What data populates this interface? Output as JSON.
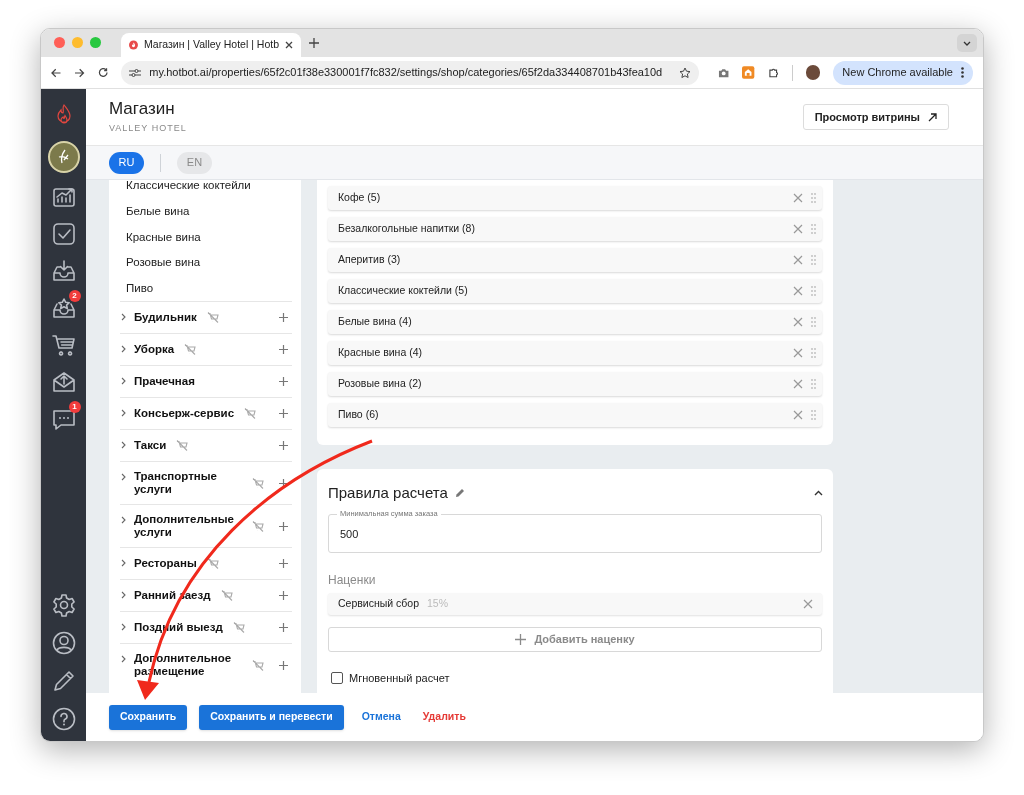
{
  "browser": {
    "tab_title": "Магазин | Valley Hotel | Hotb",
    "url": "my.hotbot.ai/properties/65f2c01f38e330001f7fc832/settings/shop/categories/65f2da334408701b43fea10d",
    "update_button": "New Chrome available"
  },
  "sidebar": {
    "items": [
      {
        "kind": "chart"
      },
      {
        "kind": "check"
      },
      {
        "kind": "inbox"
      },
      {
        "kind": "inbox-star",
        "badge": "2"
      },
      {
        "kind": "cart"
      },
      {
        "kind": "mail"
      },
      {
        "kind": "chat",
        "badge": "1"
      }
    ],
    "bottom": [
      {
        "kind": "gear"
      },
      {
        "kind": "user"
      },
      {
        "kind": "pencil"
      },
      {
        "kind": "help"
      }
    ]
  },
  "header": {
    "title": "Магазин",
    "subtitle": "VALLEY HOTEL",
    "storefront_button": "Просмотр витрины"
  },
  "languages": [
    {
      "label": "RU",
      "selected": true
    },
    {
      "label": "EN",
      "selected": false
    }
  ],
  "category_tree": {
    "subitems": [
      "Классические коктейли",
      "Белые вина",
      "Красные вина",
      "Розовые вина",
      "Пиво"
    ],
    "categories": [
      {
        "label": "Будильник",
        "hidden": true
      },
      {
        "label": "Уборка",
        "hidden": true
      },
      {
        "label": "Прачечная",
        "hidden": false
      },
      {
        "label": "Консьерж-сервис",
        "hidden": true
      },
      {
        "label": "Такси",
        "hidden": true
      },
      {
        "label": "Транспортные услуги",
        "hidden": true
      },
      {
        "label": "Дополнительные услуги",
        "hidden": true
      },
      {
        "label": "Рестораны",
        "hidden": true
      },
      {
        "label": "Ранний заезд",
        "hidden": true
      },
      {
        "label": "Поздний выезд",
        "hidden": true
      },
      {
        "label": "Дополнительное размещение",
        "hidden": true
      }
    ]
  },
  "subcategories": [
    "Кофе (5)",
    "Безалкогольные напитки (8)",
    "Аперитив (3)",
    "Классические коктейли (5)",
    "Белые вина (4)",
    "Красные вина (4)",
    "Розовые вина (2)",
    "Пиво (6)"
  ],
  "pricing": {
    "title": "Правила расчета",
    "min_order": {
      "label": "Минимальная сумма заказа",
      "value": "500"
    },
    "markups_label": "Наценки",
    "markups": [
      {
        "name": "Сервисный сбор",
        "value": "15%"
      }
    ],
    "add_markup_button": "Добавить наценку",
    "instant": {
      "label": "Мгновенный расчет",
      "checked": false
    }
  },
  "footer": {
    "save": "Сохранить",
    "save_translate": "Сохранить и перевести",
    "cancel": "Отмена",
    "delete": "Удалить"
  }
}
